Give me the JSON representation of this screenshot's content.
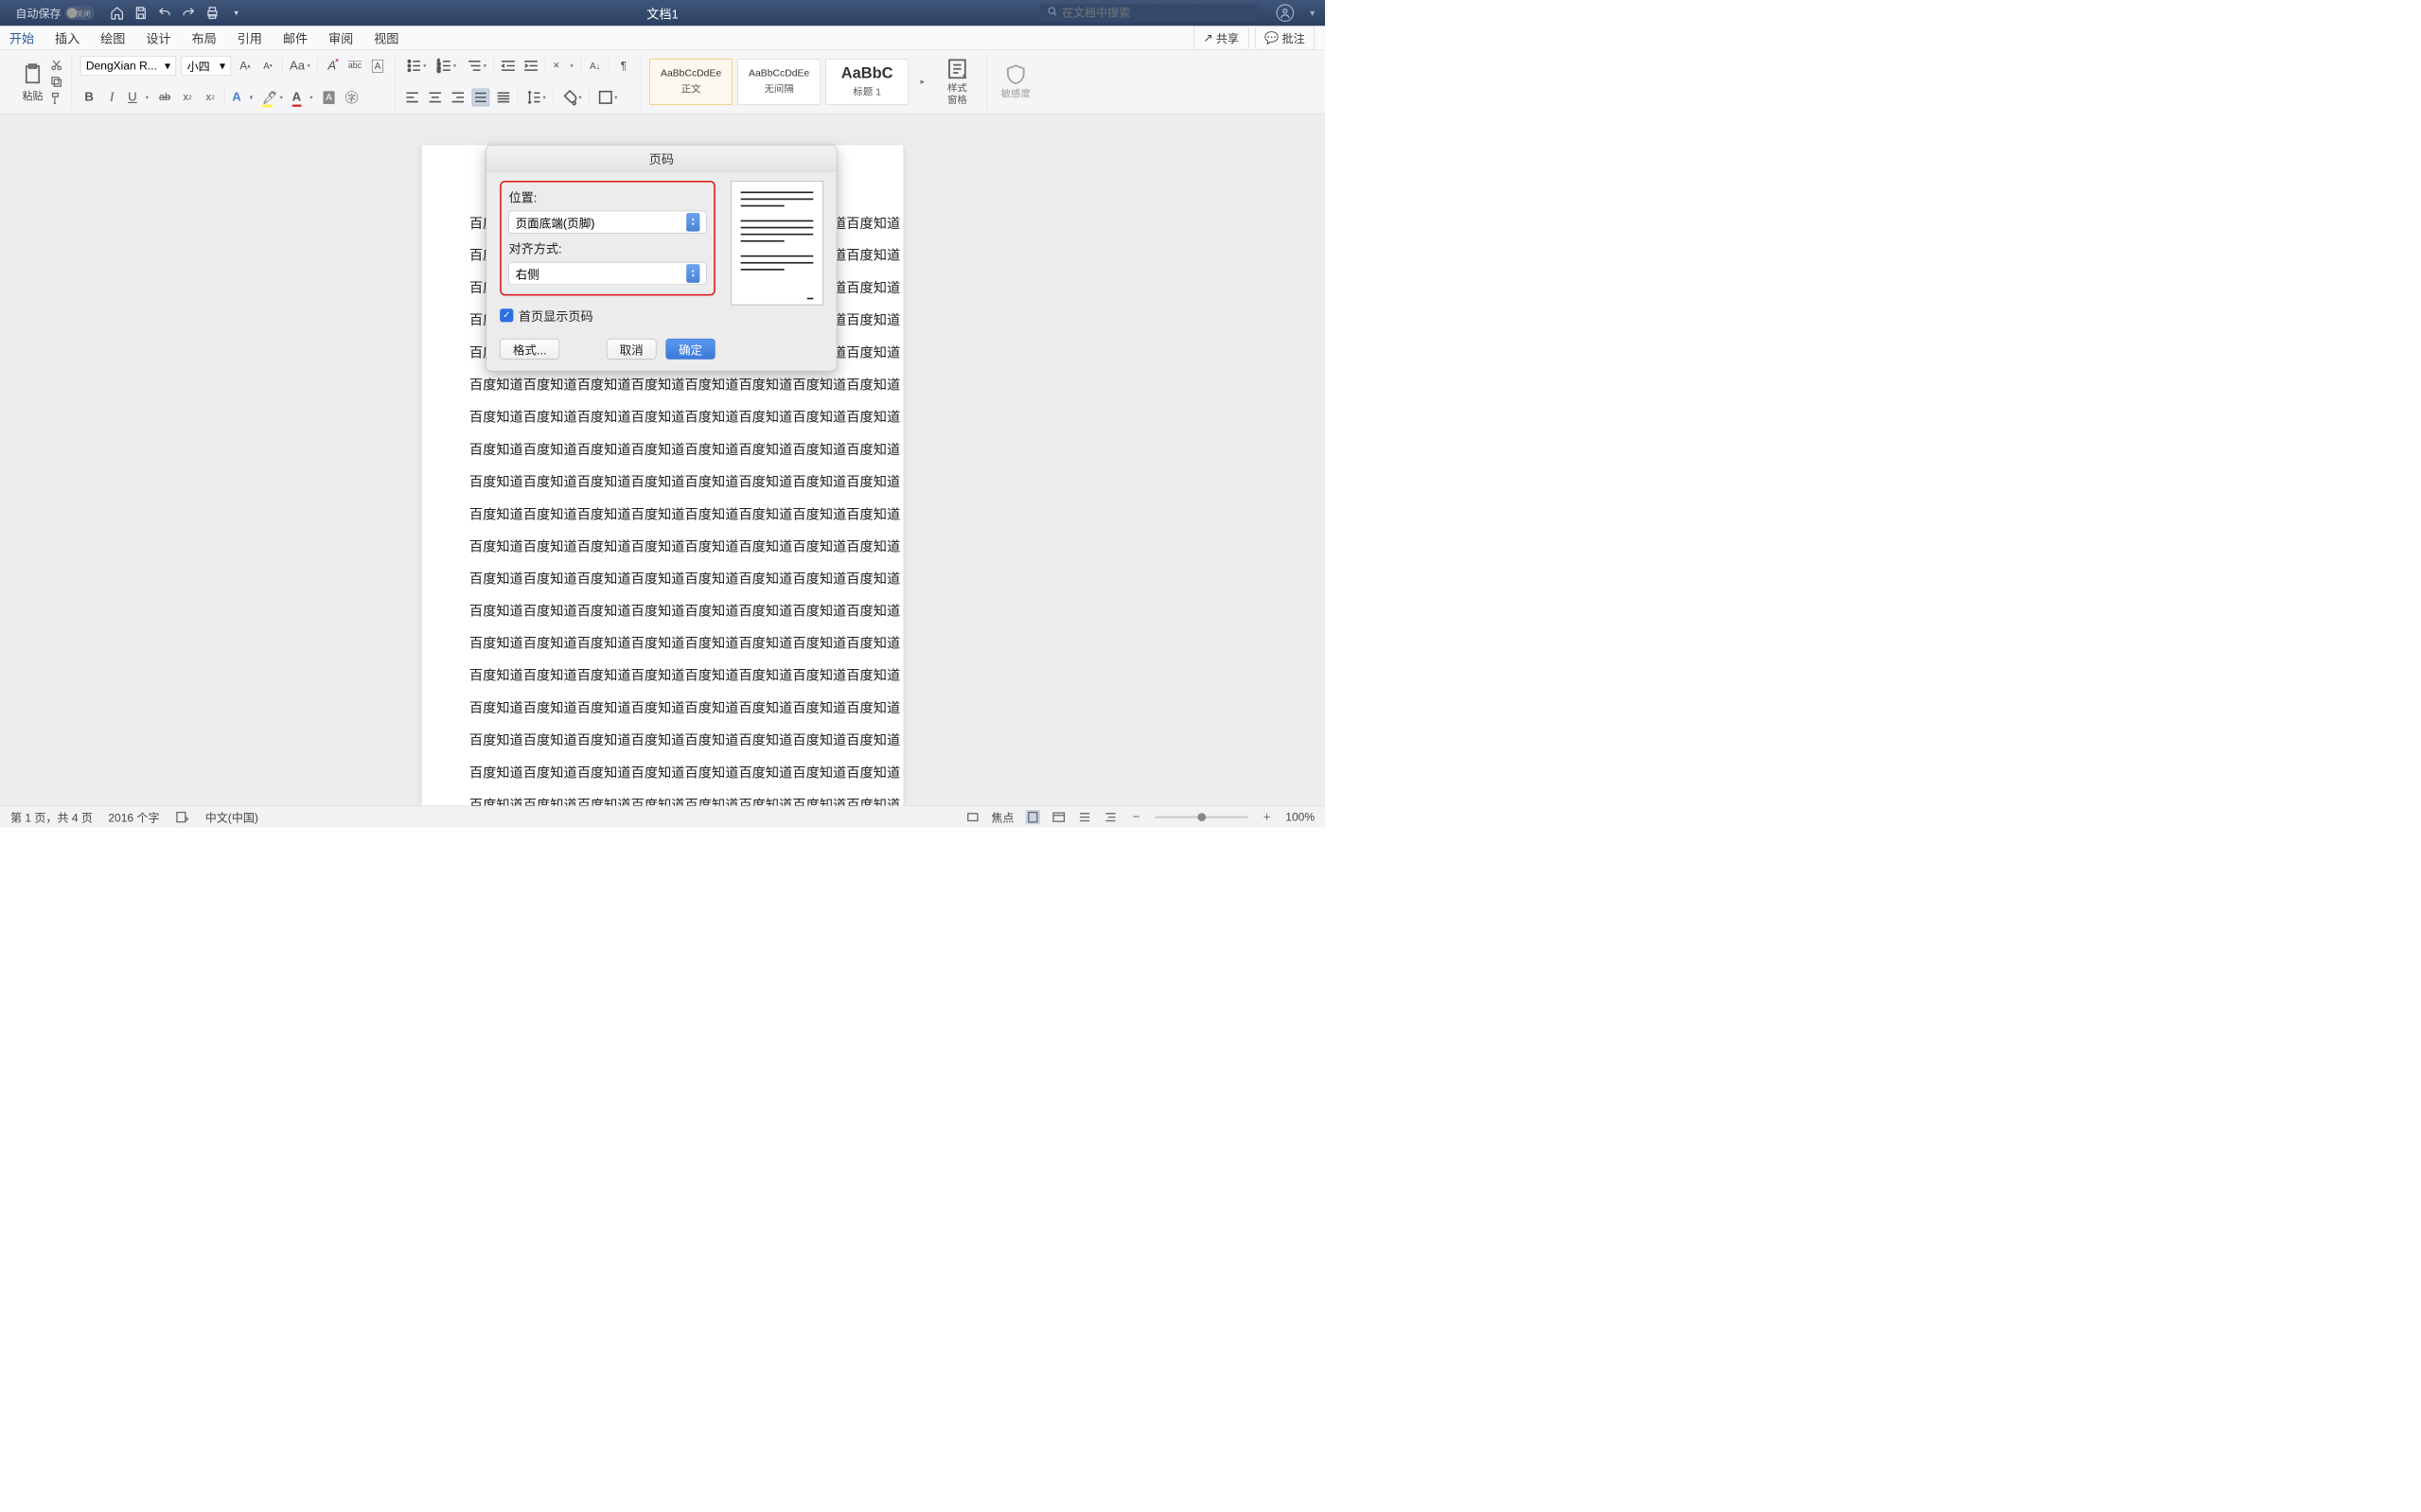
{
  "titlebar": {
    "autosave_label": "自动保存",
    "autosave_state": "关闭",
    "doc_title": "文档1",
    "search_placeholder": "在文档中搜索"
  },
  "tabs": {
    "items": [
      "开始",
      "插入",
      "绘图",
      "设计",
      "布局",
      "引用",
      "邮件",
      "审阅",
      "视图"
    ],
    "active_index": 0,
    "share": "共享",
    "comment": "批注"
  },
  "ribbon": {
    "paste": "粘贴",
    "font_name": "DengXian R...",
    "font_size": "小四",
    "styles": [
      {
        "preview": "AaBbCcDdEe",
        "label": "正文"
      },
      {
        "preview": "AaBbCcDdEe",
        "label": "无间隔"
      },
      {
        "preview": "AaBbC",
        "label": "标题 1"
      }
    ],
    "styles_pane": "样式\n窗格",
    "sensitivity": "敏感度"
  },
  "document": {
    "line": "百度知道百度知道百度知道百度知道百度知道百度知道百度知道百度知道"
  },
  "dialog": {
    "title": "页码",
    "position_label": "位置:",
    "position_value": "页面底端(页脚)",
    "align_label": "对齐方式:",
    "align_value": "右侧",
    "first_page_cb": "首页显示页码",
    "format_btn": "格式...",
    "cancel_btn": "取消",
    "ok_btn": "确定"
  },
  "statusbar": {
    "page_info": "第 1 页，共 4 页",
    "word_count": "2016 个字",
    "language": "中文(中国)",
    "focus": "焦点",
    "zoom": "100%"
  }
}
